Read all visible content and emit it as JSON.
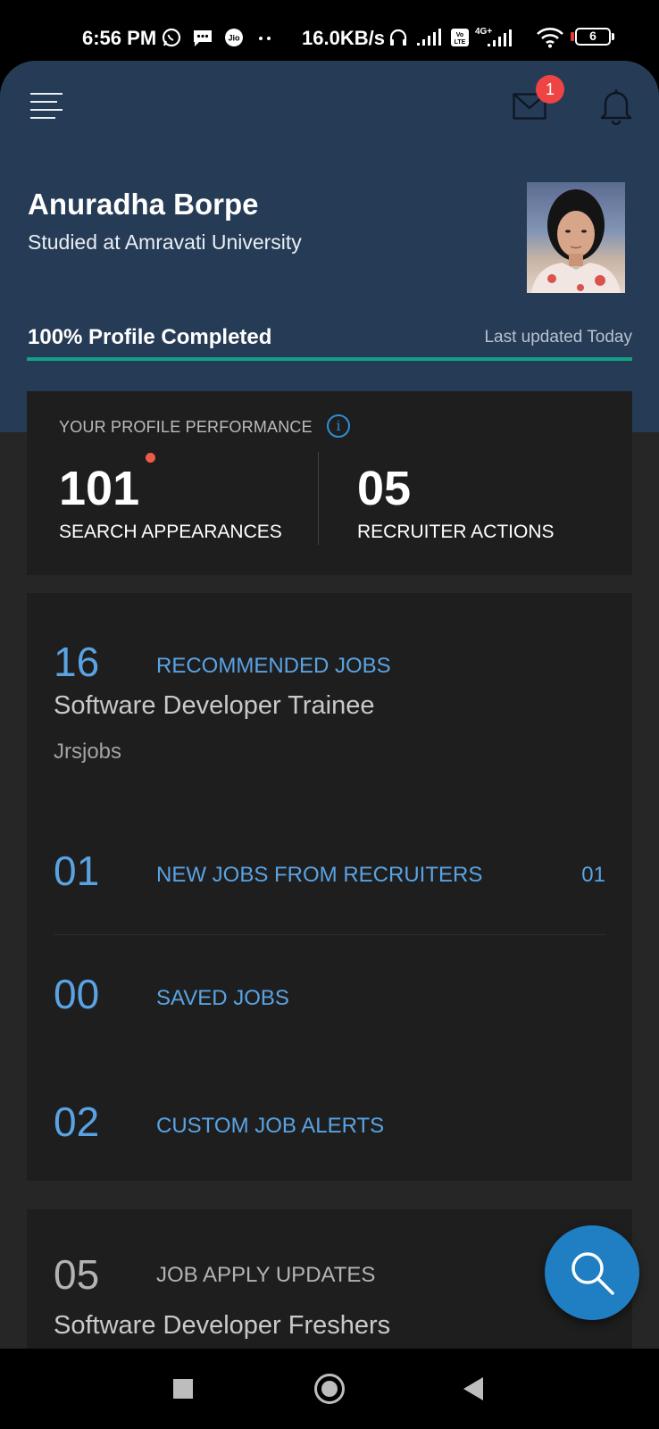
{
  "status_bar": {
    "time": "6:56 PM",
    "net_speed": "16.0KB/s",
    "battery": "6"
  },
  "header": {
    "mail_badge": "1",
    "user_name": "Anuradha Borpe",
    "user_education": "Studied at Amravati University",
    "profile_completion_text": "100% Profile Completed",
    "profile_completion": 1.0,
    "last_updated": "Last updated Today"
  },
  "performance": {
    "title": "YOUR PROFILE PERFORMANCE",
    "search_appearances": "101",
    "search_label": "SEARCH APPEARANCES",
    "recruiter_actions": "05",
    "recruiter_label": "RECRUITER ACTIONS"
  },
  "jobs": {
    "recommended_count": "16",
    "recommended_label": "RECOMMENDED JOBS",
    "recommended_title": "Software Developer Trainee",
    "recommended_company": "Jrsjobs",
    "recruiter_count": "01",
    "recruiter_label": "NEW JOBS FROM RECRUITERS",
    "recruiter_new": "01",
    "saved_count": "00",
    "saved_label": "SAVED JOBS",
    "alerts_count": "02",
    "alerts_label": "CUSTOM JOB ALERTS"
  },
  "apply_updates": {
    "count": "05",
    "label": "JOB APPLY UPDATES",
    "title": "Software Developer Freshers"
  },
  "colors": {
    "header_bg": "#263b55",
    "accent_blue": "#5aa3e3",
    "progress_green": "#12a183",
    "fab_blue": "#1f7fc2"
  },
  "icons": [
    "whatsapp-icon",
    "message-icon",
    "jio-icon",
    "headphones-icon",
    "signal-icon",
    "volte-icon",
    "wifi-icon",
    "battery-icon",
    "hamburger-menu-icon",
    "mail-icon",
    "bell-icon",
    "info-icon",
    "search-icon",
    "nav-recents-icon",
    "nav-home-icon",
    "nav-back-icon"
  ]
}
